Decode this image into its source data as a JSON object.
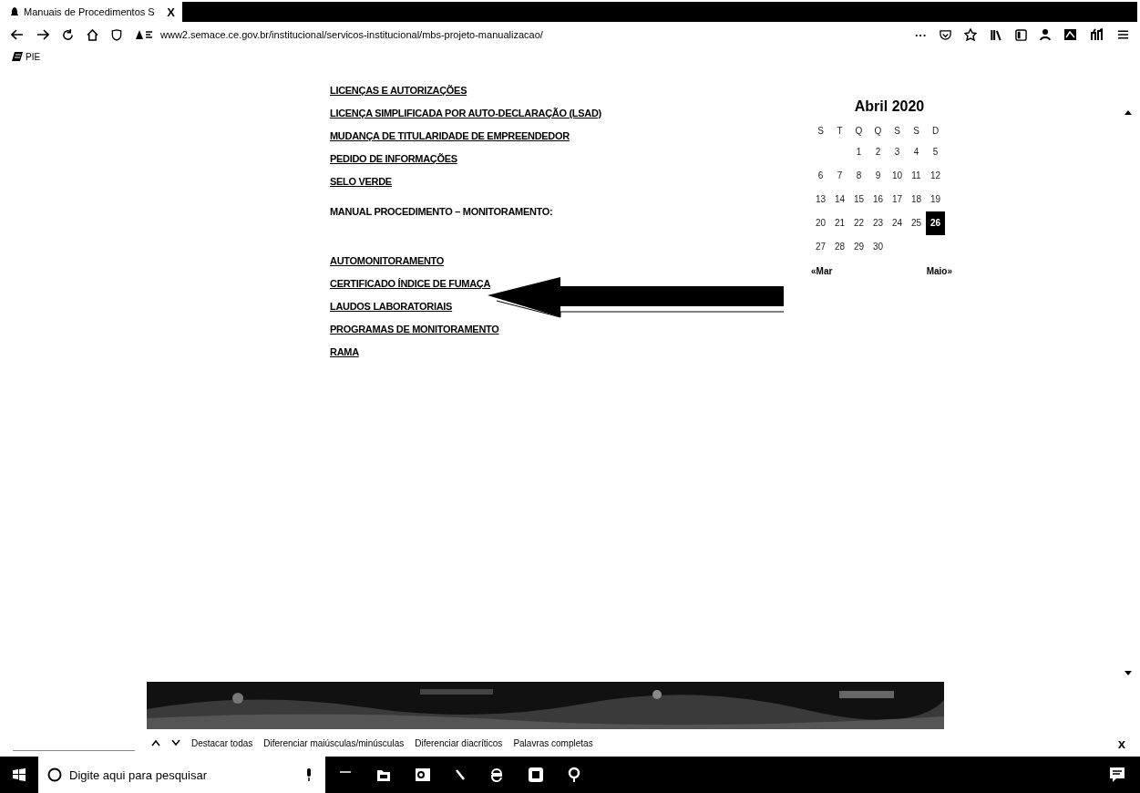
{
  "browser": {
    "tab": {
      "title": "Manuais de Procedimentos S",
      "close": "X",
      "selected": true
    },
    "url": "www2.semace.ce.gov.br/institucional/servicos-institucional/mbs-projeto-manualizacao/",
    "more": "···",
    "bookmarks": [
      {
        "label": "PIE"
      }
    ]
  },
  "links_top": [
    {
      "label": "LICENÇAS E AUTORIZAÇÕES"
    },
    {
      "label": "LICENÇA SIMPLIFICADA POR AUTO-DECLARAÇÃO (LSAD)"
    },
    {
      "label": "MUDANÇA DE TITULARIDADE DE EMPREENDEDOR"
    },
    {
      "label": "PEDIDO DE INFORMAÇÕES"
    },
    {
      "label": "SELO VERDE"
    }
  ],
  "section_heading": "MANUAL PROCEDIMENTO – MONITORAMENTO:",
  "links_bottom": [
    {
      "label": "AUTOMONITORAMENTO"
    },
    {
      "label": "CERTIFICADO ÍNDICE DE FUMAÇA"
    },
    {
      "label": "LAUDOS LABORATORIAIS"
    },
    {
      "label": "PROGRAMAS DE MONITORAMENTO"
    },
    {
      "label": "RAMA"
    }
  ],
  "calendar": {
    "title": "Abril 2020",
    "weekdays": [
      "S",
      "T",
      "Q",
      "Q",
      "S",
      "S",
      "D"
    ],
    "weeks": [
      {
        "days": [
          {
            "day": "1",
            "selected": false
          },
          {
            "day": "2",
            "selected": false
          },
          {
            "day": "3",
            "selected": false
          },
          {
            "day": "4",
            "selected": false
          },
          {
            "day": "5",
            "selected": false
          }
        ]
      },
      {
        "days": [
          {
            "day": "6",
            "selected": false
          },
          {
            "day": "7",
            "selected": false
          },
          {
            "day": "8",
            "selected": false
          },
          {
            "day": "9",
            "selected": false
          },
          {
            "day": "10",
            "selected": false
          },
          {
            "day": "11",
            "selected": false
          },
          {
            "day": "12",
            "selected": false
          }
        ]
      },
      {
        "days": [
          {
            "day": "13",
            "selected": false
          },
          {
            "day": "14",
            "selected": false
          },
          {
            "day": "15",
            "selected": false
          },
          {
            "day": "16",
            "selected": false
          },
          {
            "day": "17",
            "selected": false
          },
          {
            "day": "18",
            "selected": false
          },
          {
            "day": "19",
            "selected": false
          }
        ]
      },
      {
        "days": [
          {
            "day": "20",
            "selected": false
          },
          {
            "day": "21",
            "selected": false
          },
          {
            "day": "22",
            "selected": false
          },
          {
            "day": "23",
            "selected": false
          },
          {
            "day": "24",
            "selected": false
          },
          {
            "day": "25",
            "selected": false
          },
          {
            "day": "26",
            "selected": true
          }
        ]
      },
      {
        "days": [
          {
            "day": "27",
            "selected": false
          },
          {
            "day": "28",
            "selected": false
          },
          {
            "day": "29",
            "selected": false
          },
          {
            "day": "30",
            "selected": false
          }
        ]
      }
    ],
    "prev": "«Mar",
    "next": "Maio»"
  },
  "find_bar": {
    "options": [
      "Destacar todas",
      "Diferenciar maiúsculas/minúsculas",
      "Diferenciar diacríticos",
      "Palavras completas"
    ],
    "close": "x"
  },
  "taskbar": {
    "search_placeholder": "Digite aqui para pesquisar"
  }
}
